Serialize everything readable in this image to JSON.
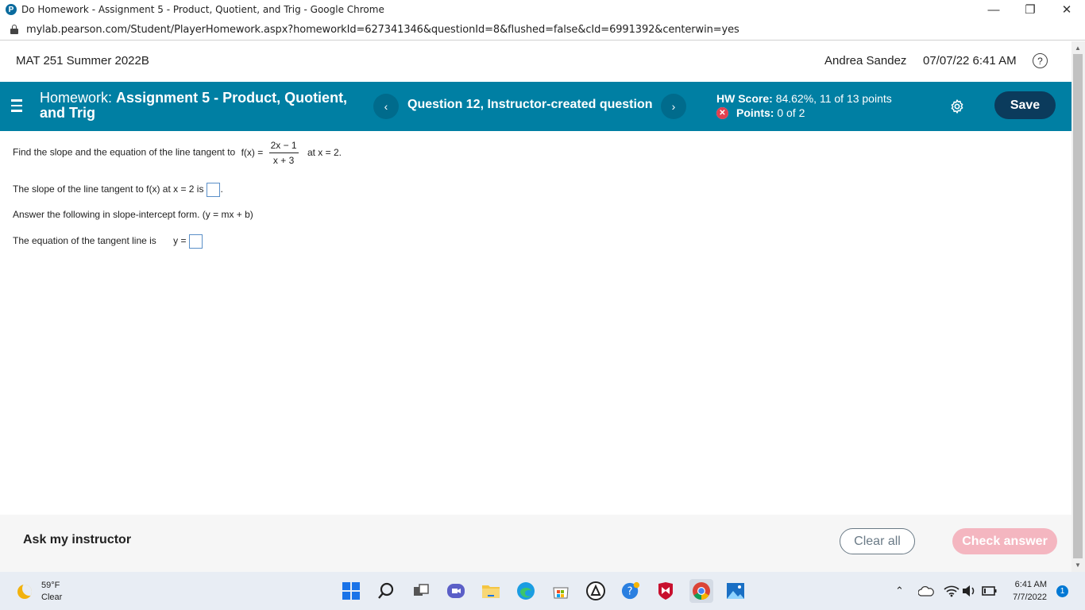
{
  "browser": {
    "window_title": "Do Homework - Assignment 5 - Product, Quotient, and Trig - Google Chrome",
    "url": "mylab.pearson.com/Student/PlayerHomework.aspx?homeworkId=627341346&questionId=8&flushed=false&cId=6991392&centerwin=yes",
    "favicon_letter": "P",
    "minimize": "—",
    "restore": "❐",
    "close": "✕"
  },
  "course": {
    "name": "MAT 251 Summer 2022B",
    "user": "Andrea Sandez",
    "datetime": "07/07/22 6:41 AM",
    "help_glyph": "?"
  },
  "hwbar": {
    "homework_prefix": "Homework:",
    "homework_title": "Assignment 5 - Product, Quotient, and Trig",
    "prev_glyph": "‹",
    "next_glyph": "›",
    "question": "Question 12, Instructor-created question",
    "score_label": "HW Score:",
    "score_value": "84.62%, 11 of 13 points",
    "points_label": "Points:",
    "points_value": "0 of 2",
    "save_label": "Save"
  },
  "question": {
    "prompt_start": "Find the slope and the equation of the line tangent to",
    "fx_label": "f(x) =",
    "numerator": "2x − 1",
    "denominator": "x + 3",
    "prompt_end": "at x = 2.",
    "slope_prompt": "The slope of the line tangent to f(x) at x = 2  is",
    "slope_period": ".",
    "form_instruction": "Answer the following in slope-intercept form.  (y = mx + b)",
    "equation_prompt": "The equation of the tangent line is",
    "y_label": "y ="
  },
  "footer": {
    "ask": "Ask my instructor",
    "clear": "Clear all",
    "check": "Check answer"
  },
  "taskbar": {
    "temperature": "59°F",
    "condition": "Clear",
    "time": "6:41 AM",
    "date": "7/7/2022",
    "notifications": "1",
    "icons": [
      "windows-start",
      "search",
      "task-view",
      "teams-chat",
      "file-explorer",
      "edge",
      "microsoft-store",
      "unknown-app",
      "help",
      "mcafee",
      "chrome",
      "photos"
    ]
  }
}
